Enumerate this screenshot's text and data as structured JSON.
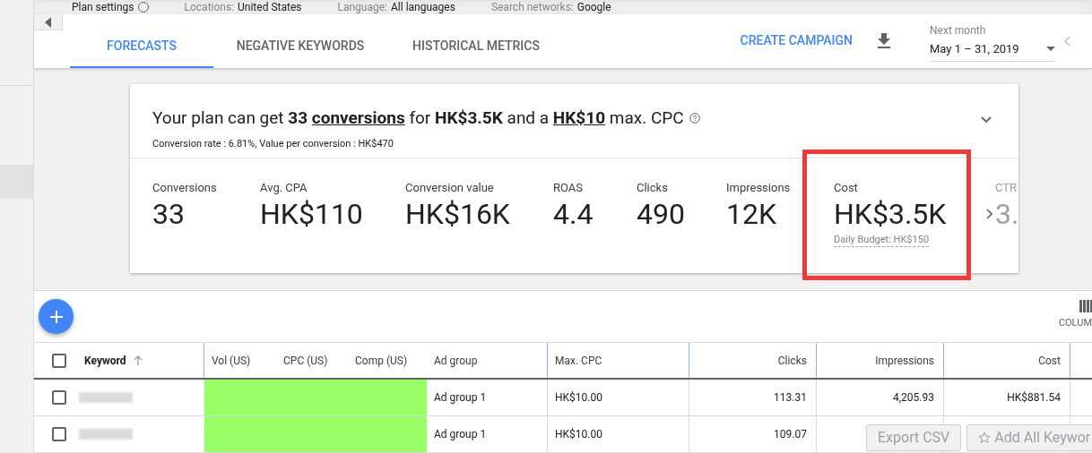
{
  "top_bar": {
    "items": [
      {
        "label": "Plan settings",
        "kind": "help"
      },
      {
        "label": "Locations:",
        "value": "United States",
        "kind": "pair"
      },
      {
        "label": "Language:",
        "value": "All languages",
        "kind": "pair"
      },
      {
        "label": "Search networks:",
        "value": "Google",
        "kind": "pair"
      }
    ]
  },
  "tabs": [
    {
      "label": "FORECASTS",
      "selected": true
    },
    {
      "label": "NEGATIVE KEYWORDS",
      "selected": false
    },
    {
      "label": "HISTORICAL METRICS",
      "selected": false
    }
  ],
  "create_campaign": "CREATE CAMPAIGN",
  "date_range": {
    "label": "Next month",
    "value": "May 1 – 31, 2019"
  },
  "summary": {
    "headline": "Your plan can get **33** **conversions** for **HK$3.5K** and a **HK$10** max. CPC",
    "subline": "Conversion rate : 6.81%, Value per conversion : HK$470"
  },
  "metrics": [
    {
      "label": "Conversions",
      "value": "33",
      "highlighted": false,
      "faded": false
    },
    {
      "label": "Avg. CPA",
      "value": "HK$110",
      "highlighted": false,
      "faded": false
    },
    {
      "label": "Conversion value",
      "value": "HK$16K",
      "highlighted": false,
      "faded": false
    },
    {
      "label": "ROAS",
      "value": "4.4",
      "highlighted": false,
      "faded": false
    },
    {
      "label": "Clicks",
      "value": "490",
      "highlighted": false,
      "faded": false
    },
    {
      "label": "Impressions",
      "value": "12K",
      "highlighted": false,
      "faded": false
    },
    {
      "label": "Cost",
      "value": "HK$3.5K",
      "note": "Daily Budget: HK$150",
      "highlighted": true,
      "faded": false
    },
    {
      "label": "CTR",
      "value": "3.",
      "highlighted": false,
      "faded": true
    }
  ],
  "columns_button": "COLUM",
  "table": {
    "all_checked": false,
    "columns": [
      "Keyword",
      "Vol (US)",
      "CPC (US)",
      "Comp (US)",
      "Ad group",
      "Max. CPC",
      "Clicks",
      "Impressions",
      "Cost"
    ],
    "rows": [
      {
        "ad_group": "Ad group 1",
        "max_cpc": "HK$10.00",
        "clicks": "113.31",
        "impressions": "4,205.93",
        "cost": "HK$881.54",
        "checked": false
      },
      {
        "ad_group": "Ad group 1",
        "max_cpc": "HK$10.00",
        "clicks": "109.07",
        "checked": false
      }
    ]
  },
  "overlay_buttons": [
    "Export CSV",
    "Add All Keywor"
  ]
}
